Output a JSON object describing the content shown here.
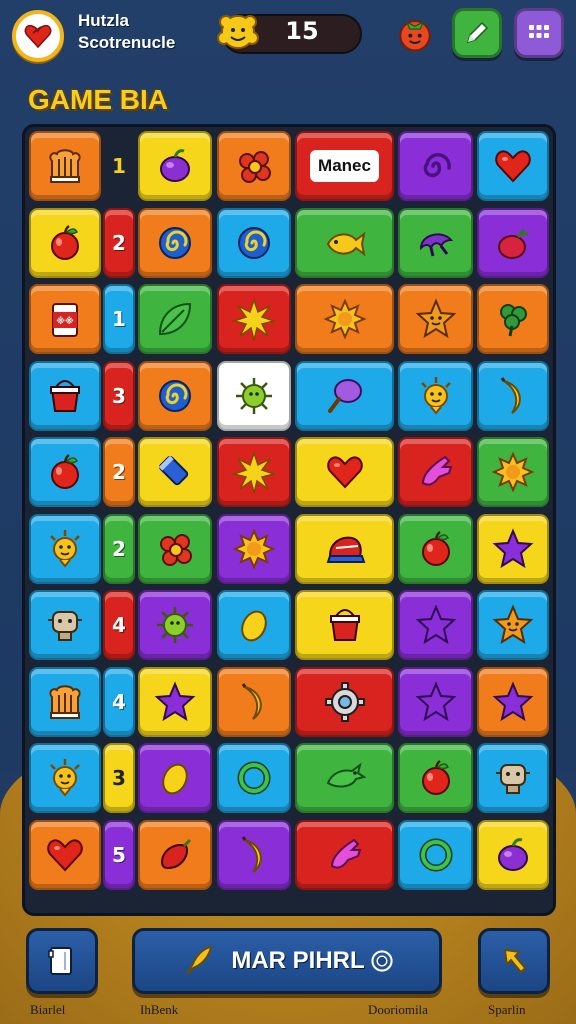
{
  "header": {
    "title_line1": "Hutzla",
    "title_line2": "Scotrenucle",
    "score": "15"
  },
  "game_label": "GAME BIA",
  "board": {
    "special_text": "Manec",
    "row_numbers": [
      "1",
      "2",
      "1",
      "3",
      "2",
      "2",
      "4",
      "4",
      "3",
      "5"
    ]
  },
  "bottom": {
    "play_label": "MAR PIHRL"
  },
  "footer": {
    "label1": "Biarlel",
    "label2": "IhBenk",
    "label3": "Dooriomila",
    "label4": "Sparlin"
  },
  "colors": {
    "orange": "#f07c1c",
    "yellow": "#f5d61a",
    "red": "#d8231e",
    "purple": "#8a2fd8",
    "blue": "#1ea9e8",
    "green": "#3fb53f",
    "white": "#ffffff"
  },
  "tiles": [
    {
      "row": 0,
      "col": 0,
      "color": "orange",
      "icon": "chef-hat-icon"
    },
    {
      "row": 0,
      "col": 1,
      "color": "none",
      "number": "1"
    },
    {
      "row": 0,
      "col": 2,
      "color": "yellow",
      "icon": "plum-icon"
    },
    {
      "row": 0,
      "col": 3,
      "color": "orange",
      "icon": "flower-icon"
    },
    {
      "row": 0,
      "col": 4,
      "color": "red",
      "text": true
    },
    {
      "row": 0,
      "col": 5,
      "color": "purple",
      "icon": "swirl-icon"
    },
    {
      "row": 0,
      "col": 6,
      "color": "blue",
      "icon": "heart-icon"
    },
    {
      "row": 1,
      "col": 0,
      "color": "yellow",
      "icon": "apple-icon"
    },
    {
      "row": 1,
      "col": 1,
      "color": "red",
      "number": "2"
    },
    {
      "row": 1,
      "col": 2,
      "color": "orange",
      "icon": "spiral-icon"
    },
    {
      "row": 1,
      "col": 3,
      "color": "blue",
      "icon": "spiral-icon"
    },
    {
      "row": 1,
      "col": 4,
      "color": "green",
      "icon": "fish-icon"
    },
    {
      "row": 1,
      "col": 5,
      "color": "green",
      "icon": "claw-icon"
    },
    {
      "row": 1,
      "col": 6,
      "color": "purple",
      "icon": "berry-icon"
    },
    {
      "row": 2,
      "col": 0,
      "color": "orange",
      "icon": "can-icon"
    },
    {
      "row": 2,
      "col": 1,
      "color": "blue",
      "number": "1"
    },
    {
      "row": 2,
      "col": 2,
      "color": "green",
      "icon": "leaf-icon"
    },
    {
      "row": 2,
      "col": 3,
      "color": "red",
      "icon": "burst-icon"
    },
    {
      "row": 2,
      "col": 4,
      "color": "orange",
      "icon": "sun-icon"
    },
    {
      "row": 2,
      "col": 5,
      "color": "orange",
      "icon": "star-face-icon"
    },
    {
      "row": 2,
      "col": 6,
      "color": "orange",
      "icon": "clover-icon"
    },
    {
      "row": 3,
      "col": 0,
      "color": "blue",
      "icon": "bucket-icon"
    },
    {
      "row": 3,
      "col": 1,
      "color": "red",
      "number": "3"
    },
    {
      "row": 3,
      "col": 2,
      "color": "orange",
      "icon": "spiral-icon"
    },
    {
      "row": 3,
      "col": 3,
      "color": "white",
      "icon": "virus-icon"
    },
    {
      "row": 3,
      "col": 4,
      "color": "blue",
      "icon": "lollipop-icon"
    },
    {
      "row": 3,
      "col": 5,
      "color": "blue",
      "icon": "sun-face-icon"
    },
    {
      "row": 3,
      "col": 6,
      "color": "blue",
      "icon": "banana-icon"
    },
    {
      "row": 4,
      "col": 0,
      "color": "blue",
      "icon": "apple-icon"
    },
    {
      "row": 4,
      "col": 1,
      "color": "orange",
      "number": "2"
    },
    {
      "row": 4,
      "col": 2,
      "color": "yellow",
      "icon": "crayon-icon"
    },
    {
      "row": 4,
      "col": 3,
      "color": "red",
      "icon": "burst-icon"
    },
    {
      "row": 4,
      "col": 4,
      "color": "yellow",
      "icon": "heart-icon"
    },
    {
      "row": 4,
      "col": 5,
      "color": "red",
      "icon": "glove-icon"
    },
    {
      "row": 4,
      "col": 6,
      "color": "green",
      "icon": "sun-icon"
    },
    {
      "row": 5,
      "col": 0,
      "color": "blue",
      "icon": "sun-face-icon"
    },
    {
      "row": 5,
      "col": 1,
      "color": "green",
      "number": "2"
    },
    {
      "row": 5,
      "col": 2,
      "color": "green",
      "icon": "flower-icon"
    },
    {
      "row": 5,
      "col": 3,
      "color": "purple",
      "icon": "sun-icon"
    },
    {
      "row": 5,
      "col": 4,
      "color": "yellow",
      "icon": "cap-icon"
    },
    {
      "row": 5,
      "col": 5,
      "color": "green",
      "icon": "apple-icon"
    },
    {
      "row": 5,
      "col": 6,
      "color": "yellow",
      "icon": "star-icon"
    },
    {
      "row": 6,
      "col": 0,
      "color": "blue",
      "icon": "robot-icon"
    },
    {
      "row": 6,
      "col": 1,
      "color": "red",
      "number": "4"
    },
    {
      "row": 6,
      "col": 2,
      "color": "purple",
      "icon": "virus-icon"
    },
    {
      "row": 6,
      "col": 3,
      "color": "blue",
      "icon": "lemon-icon"
    },
    {
      "row": 6,
      "col": 4,
      "color": "yellow",
      "icon": "bucket-icon"
    },
    {
      "row": 6,
      "col": 5,
      "color": "purple",
      "icon": "star-icon"
    },
    {
      "row": 6,
      "col": 6,
      "color": "blue",
      "icon": "star-face-icon"
    },
    {
      "row": 7,
      "col": 0,
      "color": "blue",
      "icon": "chef-hat-icon"
    },
    {
      "row": 7,
      "col": 1,
      "color": "blue",
      "number": "4"
    },
    {
      "row": 7,
      "col": 2,
      "color": "yellow",
      "icon": "star-icon"
    },
    {
      "row": 7,
      "col": 3,
      "color": "orange",
      "icon": "banana-icon"
    },
    {
      "row": 7,
      "col": 4,
      "color": "red",
      "icon": "gear-icon"
    },
    {
      "row": 7,
      "col": 5,
      "color": "purple",
      "icon": "star-icon"
    },
    {
      "row": 7,
      "col": 6,
      "color": "orange",
      "icon": "star-icon"
    },
    {
      "row": 8,
      "col": 0,
      "color": "blue",
      "icon": "sun-face-icon"
    },
    {
      "row": 8,
      "col": 1,
      "color": "yellow",
      "number": "3"
    },
    {
      "row": 8,
      "col": 2,
      "color": "purple",
      "icon": "lemon-icon"
    },
    {
      "row": 8,
      "col": 3,
      "color": "blue",
      "icon": "ring-icon"
    },
    {
      "row": 8,
      "col": 4,
      "color": "green",
      "icon": "dragon-icon"
    },
    {
      "row": 8,
      "col": 5,
      "color": "green",
      "icon": "apple-icon"
    },
    {
      "row": 8,
      "col": 6,
      "color": "blue",
      "icon": "robot-icon"
    },
    {
      "row": 9,
      "col": 0,
      "color": "orange",
      "icon": "heart-icon"
    },
    {
      "row": 9,
      "col": 1,
      "color": "purple",
      "number": "5"
    },
    {
      "row": 9,
      "col": 2,
      "color": "orange",
      "icon": "pepper-icon"
    },
    {
      "row": 9,
      "col": 3,
      "color": "purple",
      "icon": "banana-icon"
    },
    {
      "row": 9,
      "col": 4,
      "color": "red",
      "icon": "glove-icon"
    },
    {
      "row": 9,
      "col": 5,
      "color": "blue",
      "icon": "ring-icon"
    },
    {
      "row": 9,
      "col": 6,
      "color": "yellow",
      "icon": "plum-icon"
    }
  ]
}
